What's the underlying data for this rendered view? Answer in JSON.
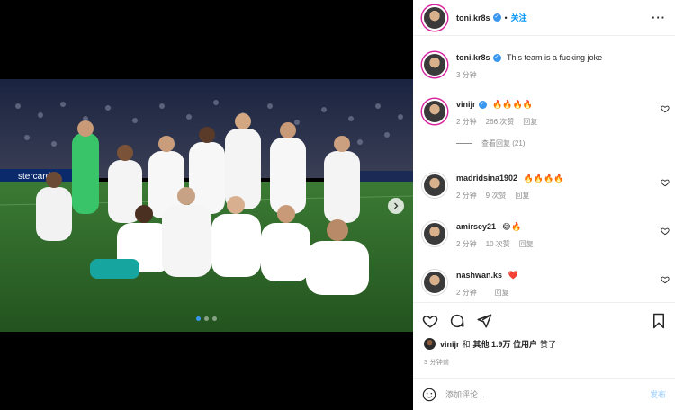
{
  "post": {
    "author": "toni.kr8s",
    "follow_label": "关注",
    "more_label": "···",
    "caption": "This team is a fucking joke",
    "caption_time": "3 分钟"
  },
  "comments": [
    {
      "user": "vinijr",
      "verified": true,
      "text": "🔥🔥🔥🔥",
      "time": "2 分钟",
      "likes": "266 次赞",
      "reply": "回复",
      "view_replies": "查看回复 (21)"
    },
    {
      "user": "madridsina1902",
      "verified": false,
      "text": "🔥🔥🔥🔥",
      "time": "2 分钟",
      "likes": "9 次赞",
      "reply": "回复"
    },
    {
      "user": "amirsey21",
      "verified": false,
      "text": "😂🔥",
      "time": "2 分钟",
      "likes": "10 次赞",
      "reply": "回复"
    },
    {
      "user": "nashwan.ks",
      "verified": false,
      "text": "❤️",
      "time": "2 分钟",
      "likes": "",
      "reply": "回复"
    }
  ],
  "likes_line": {
    "first_user": "vinijr",
    "and": "和",
    "others": "其他 1.9万 位用户",
    "suffix": "赞了"
  },
  "timestamp": "3 分钟前",
  "add_comment": {
    "placeholder": "添加评论...",
    "post_label": "发布"
  },
  "photo": {
    "banner_text": "stercard"
  },
  "carousel": {
    "total": 3,
    "active": 1
  },
  "colors": {
    "accent": "#0095f6",
    "verified": "#3897f0",
    "pitch": "#2f6b2a",
    "heart": "#ed4956"
  }
}
